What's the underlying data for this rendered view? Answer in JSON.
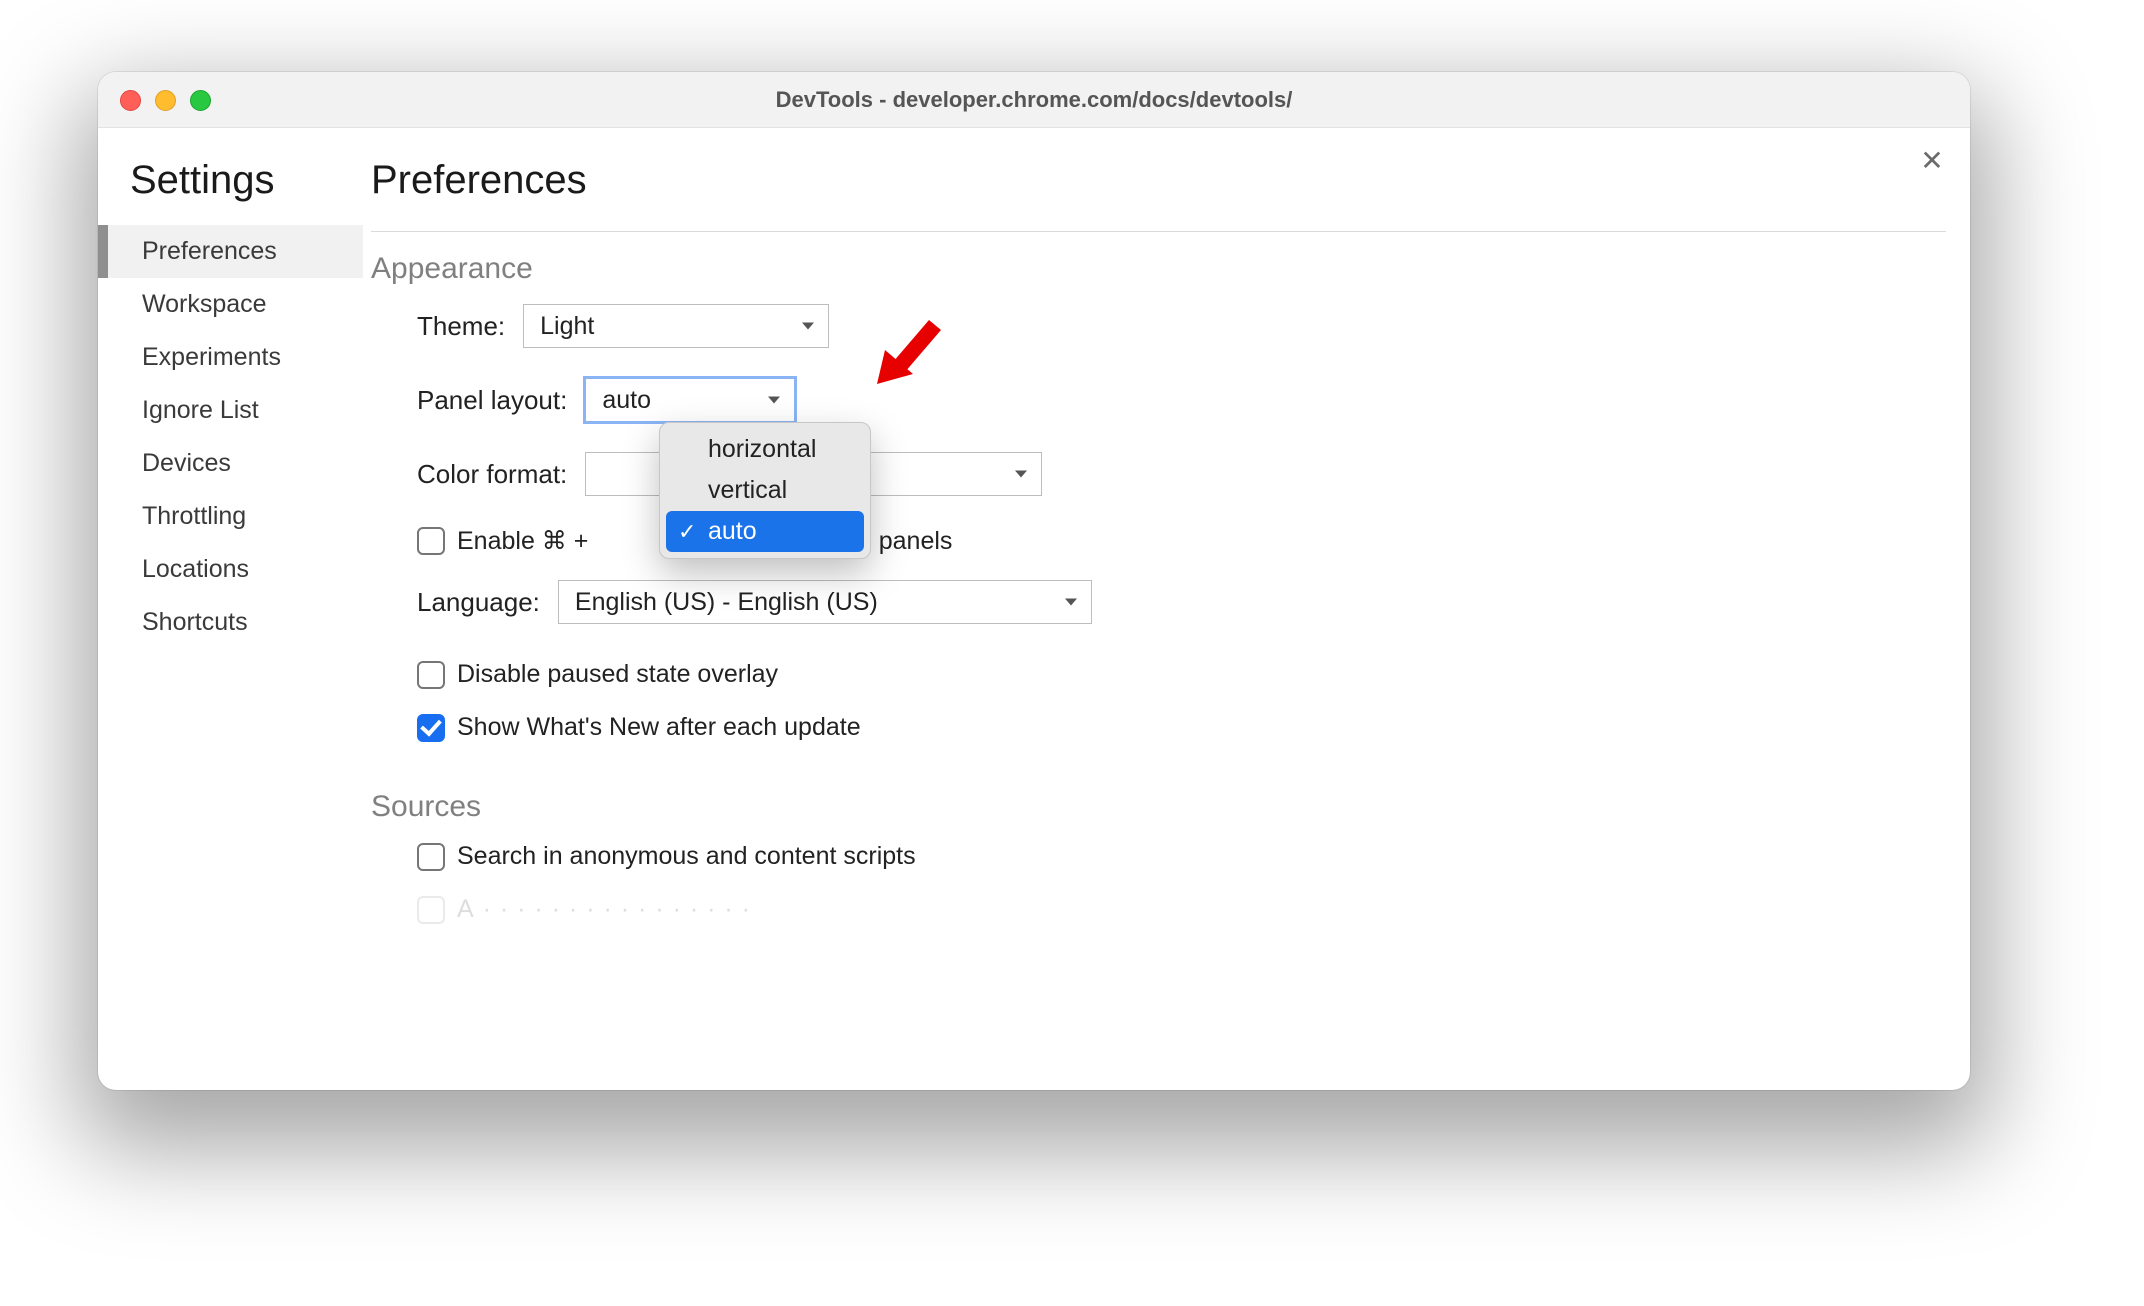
{
  "window": {
    "title": "DevTools - developer.chrome.com/docs/devtools/"
  },
  "settings": {
    "title": "Settings",
    "sidebar": {
      "items": [
        {
          "label": "Preferences",
          "active": true
        },
        {
          "label": "Workspace",
          "active": false
        },
        {
          "label": "Experiments",
          "active": false
        },
        {
          "label": "Ignore List",
          "active": false
        },
        {
          "label": "Devices",
          "active": false
        },
        {
          "label": "Throttling",
          "active": false
        },
        {
          "label": "Locations",
          "active": false
        },
        {
          "label": "Shortcuts",
          "active": false
        }
      ]
    },
    "page_title": "Preferences"
  },
  "appearance": {
    "section_title": "Appearance",
    "theme": {
      "label": "Theme:",
      "value": "Light"
    },
    "panel_layout": {
      "label": "Panel layout:",
      "value": "auto",
      "options": [
        "horizontal",
        "vertical",
        "auto"
      ],
      "selected_index": 2,
      "open": true
    },
    "color_format": {
      "label": "Color format:",
      "value": ""
    },
    "shortcut_checkbox": {
      "label_prefix": "Enable ⌘ +",
      "label_suffix": "switch panels",
      "checked": false
    },
    "language": {
      "label": "Language:",
      "value": "English (US) - English (US)"
    },
    "disable_paused": {
      "label": "Disable paused state overlay",
      "checked": false
    },
    "whats_new": {
      "label": "Show What's New after each update",
      "checked": true
    }
  },
  "sources": {
    "section_title": "Sources",
    "search_anon": {
      "label": "Search in anonymous and content scripts",
      "checked": false
    }
  },
  "annotation": {
    "color": "#e60000"
  }
}
